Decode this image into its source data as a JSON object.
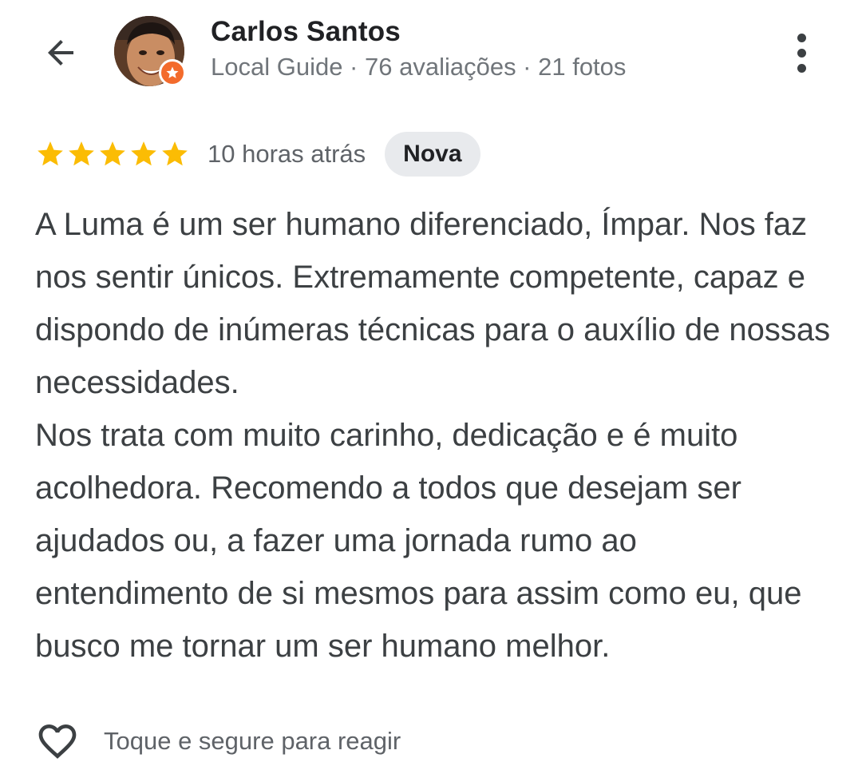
{
  "header": {
    "back_icon": "arrow-back-icon",
    "user_name": "Carlos Santos",
    "user_meta": "Local Guide · 76 avaliações · 21 fotos",
    "badge_icon": "local-guide-star-icon",
    "more_icon": "more-vert-icon"
  },
  "review": {
    "rating": 5,
    "rating_max": 5,
    "time_ago": "10 horas atrás",
    "new_badge": "Nova",
    "paragraphs": [
      "A Luma é um ser humano diferenciado, Ímpar. Nos faz nos sentir únicos. Extremamente competente, capaz e dispondo de inúmeras técnicas para o auxílio de nossas necessidades.",
      "Nos trata com muito carinho, dedicação e é muito acolhedora. Recomendo a todos que desejam ser ajudados ou, a fazer uma jornada rumo ao entendimento de si mesmos para assim como eu, que busco me tornar um ser humano melhor."
    ]
  },
  "reaction": {
    "icon": "heart-outline-icon",
    "label": "Toque e segure para reagir"
  },
  "colors": {
    "star": "#fbbc04",
    "badge_bg": "#e8eaed",
    "guide_badge": "#f36b2c",
    "text_primary": "#202124",
    "text_body": "#3c4043",
    "text_secondary": "#70757a"
  }
}
